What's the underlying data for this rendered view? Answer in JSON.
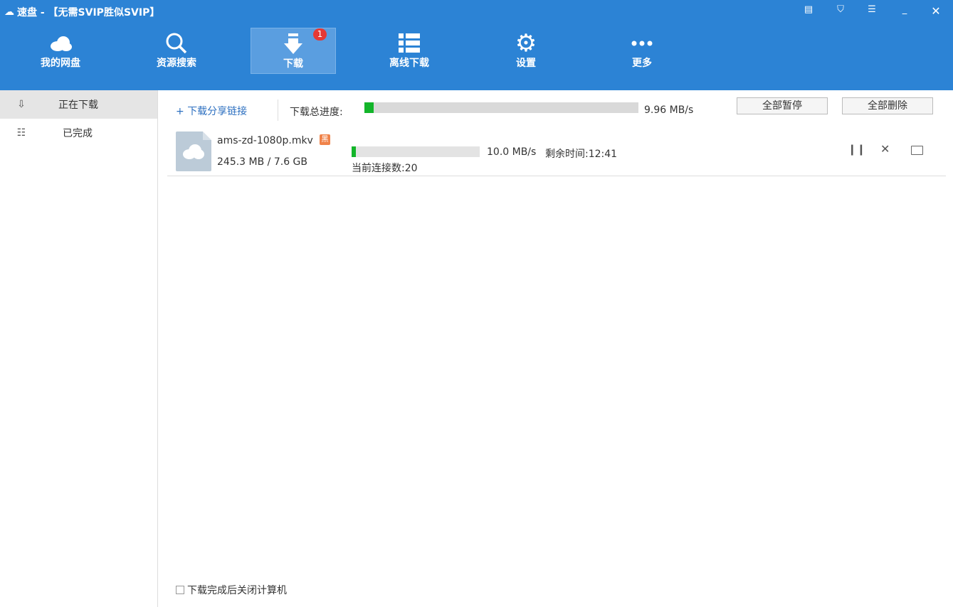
{
  "app": {
    "title": "速盘 - 【无需SVIP胜似SVIP】"
  },
  "nav": [
    {
      "label": "我的网盘"
    },
    {
      "label": "资源搜索"
    },
    {
      "label": "下载",
      "badge": "1"
    },
    {
      "label": "离线下载"
    },
    {
      "label": "设置"
    },
    {
      "label": "更多"
    }
  ],
  "sidebar": {
    "items": [
      {
        "label": "正在下载"
      },
      {
        "label": "已完成"
      }
    ]
  },
  "toolbar": {
    "add_link": "下载分享链接",
    "total_label": "下载总进度:",
    "total_speed": "9.96 MB/s",
    "total_progress": 0.035,
    "pause_all": "全部暂停",
    "delete_all": "全部删除"
  },
  "downloads": [
    {
      "name": "ams-zd-1080p.mkv",
      "tag": "黑",
      "size": "245.3 MB / 7.6 GB",
      "speed": "10.0 MB/s",
      "remaining": "剩余时间:12:41",
      "connections": "当前连接数:20",
      "progress": 0.032
    }
  ],
  "footer": {
    "shutdown_label": "下载完成后关闭计算机",
    "shutdown_checked": false
  }
}
